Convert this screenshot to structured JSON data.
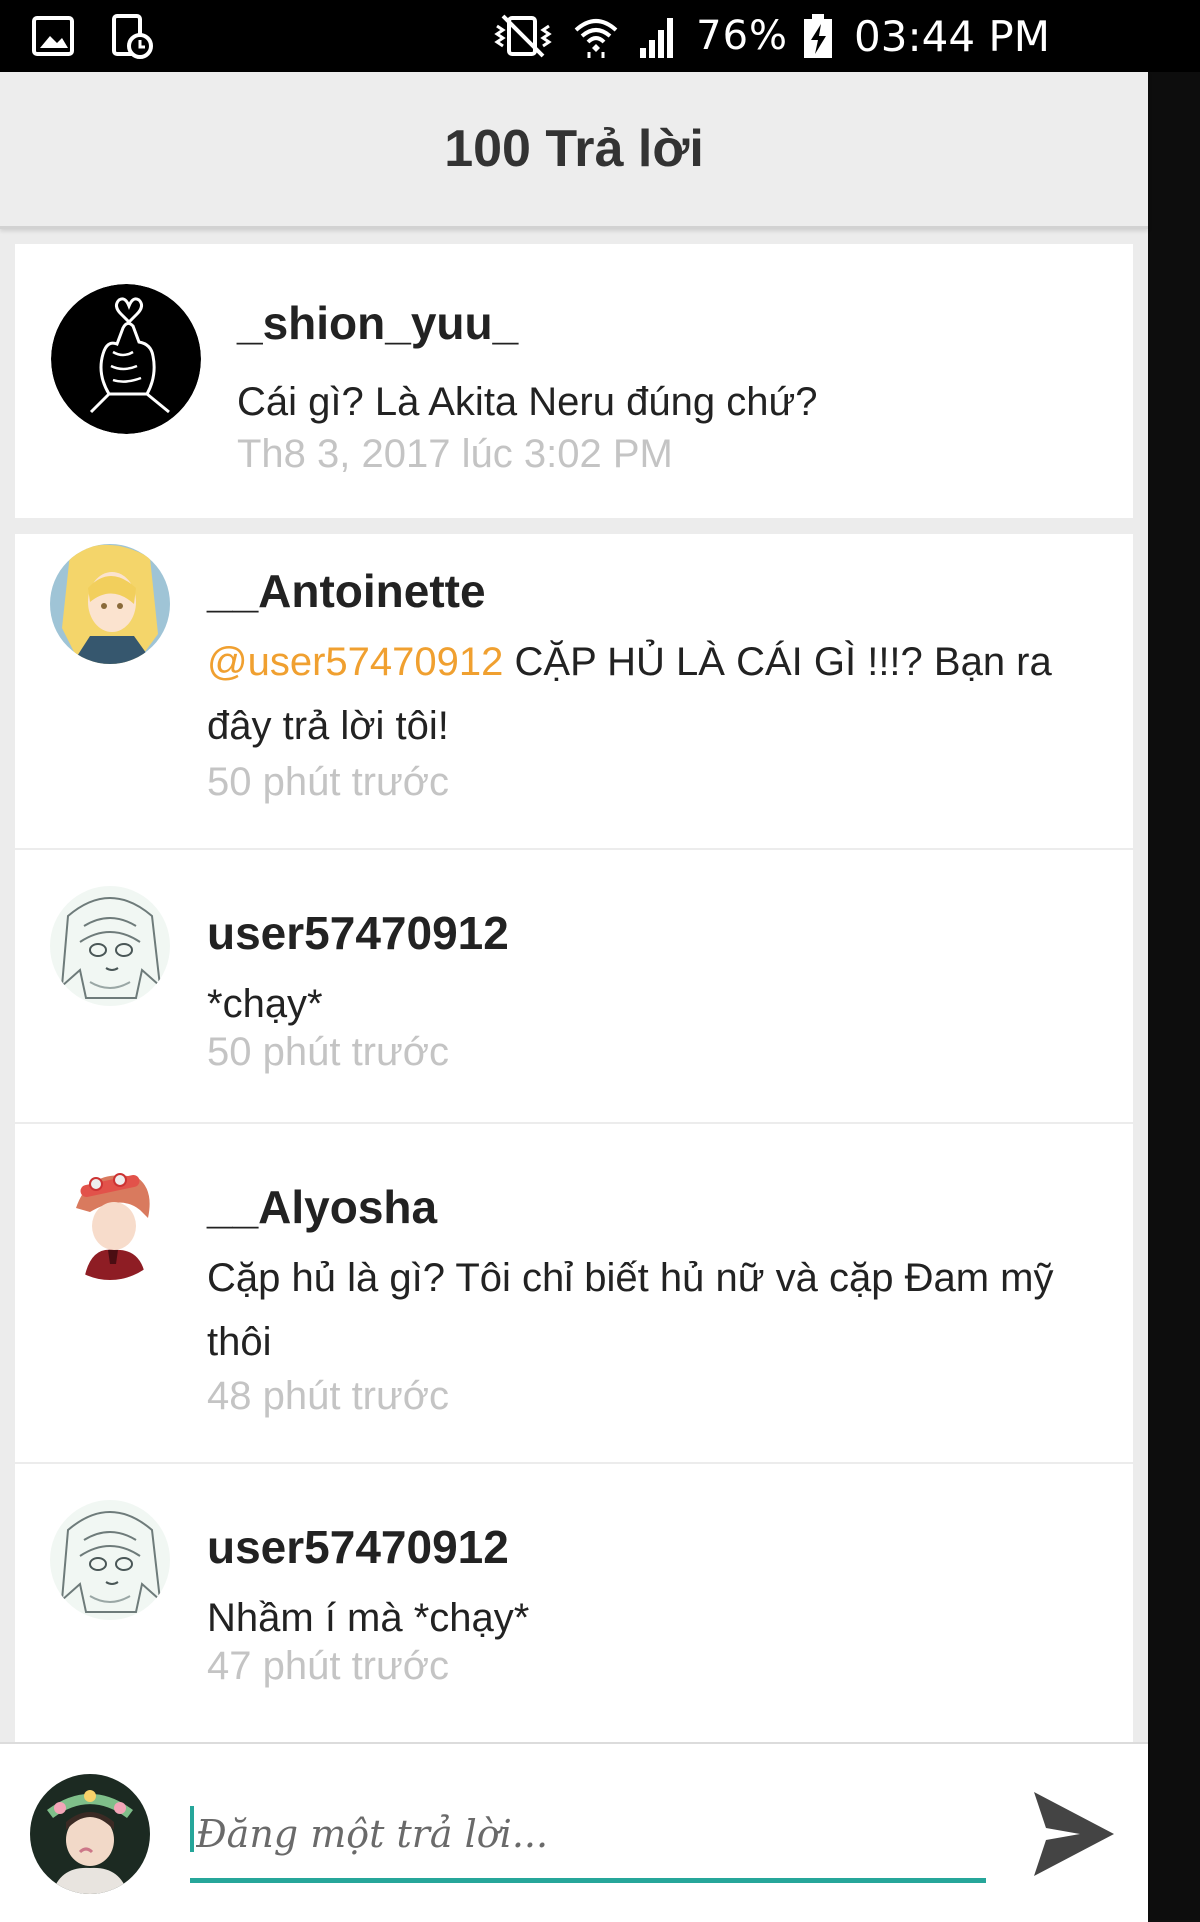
{
  "status_bar": {
    "battery": "76%",
    "time": "03:44 PM",
    "icons": [
      "gallery-icon",
      "screenshot-clock-icon",
      "vibrate-mute-icon",
      "wifi-icon",
      "signal-icon",
      "battery-charging-icon"
    ]
  },
  "header": {
    "title": "100 Trả lời"
  },
  "parent_post": {
    "username": "_shion_yuu_",
    "text": "Cái gì? Là Akita Neru đúng chứ?",
    "time": "Th8 3, 2017 lúc 3:02 PM"
  },
  "replies": [
    {
      "username": "__Antoinette",
      "mention": "@user57470912",
      "text": " CẶP HỦ LÀ CÁI GÌ !!!? Bạn ra đây trả lời tôi!",
      "time": "50 phút trước"
    },
    {
      "username": "user57470912",
      "text": "*chạy*",
      "time": "50 phút trước"
    },
    {
      "username": "__Alyosha",
      "text": "Cặp hủ là gì? Tôi chỉ biết hủ nữ và cặp Đam mỹ thôi",
      "time": "48 phút trước"
    },
    {
      "username": "user57470912",
      "text": "Nhầm í mà *chạy*",
      "time": "47 phút trước"
    }
  ],
  "compose": {
    "placeholder": "Đăng một trả lời..."
  },
  "colors": {
    "accent": "#26a69a",
    "mention": "#f0a030",
    "timestamp": "#c4c4c4"
  }
}
